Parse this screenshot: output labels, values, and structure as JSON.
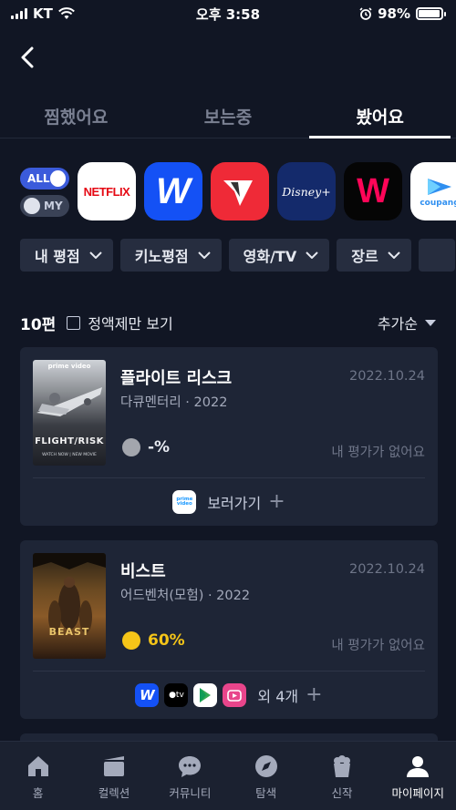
{
  "status_bar": {
    "carrier": "KT",
    "time": "오후 3:58",
    "battery": "98%",
    "battery_level": 0.98
  },
  "tabs": [
    {
      "label": "찜했어요",
      "active": false
    },
    {
      "label": "보는중",
      "active": false
    },
    {
      "label": "봤어요",
      "active": true
    }
  ],
  "ott_toggles": {
    "all_label": "ALL",
    "my_label": "MY"
  },
  "ott_services": [
    {
      "name": "netflix-icon",
      "label": "NETFLIX"
    },
    {
      "name": "wavve-icon",
      "label": "W"
    },
    {
      "name": "tving-icon",
      "label": "T"
    },
    {
      "name": "disney-plus-icon",
      "label": "Disney+"
    },
    {
      "name": "watcha-icon",
      "label": "W"
    },
    {
      "name": "coupang-play-icon",
      "label": "coupang"
    }
  ],
  "filters": [
    "내 평점",
    "키노평점",
    "영화/TV",
    "장르"
  ],
  "list": {
    "count": "10편",
    "checkbox_label": "정액제만 보기",
    "sort_label": "추가순"
  },
  "cards": [
    {
      "title": "플라이트 리스크",
      "meta": "다큐멘터리 · 2022",
      "date": "2022.10.24",
      "score": "-%",
      "my_rating": "내 평가가 없어요",
      "poster_brand": "prime video",
      "poster_title": "FLIGHT/RISK",
      "poster_tag": "WATCH NOW | NEW MOVIE",
      "footer_provider": "prime video",
      "footer_label": "보러가기"
    },
    {
      "title": "비스트",
      "meta": "어드벤처(모험) · 2022",
      "date": "2022.10.24",
      "score": "60%",
      "my_rating": "내 평가가 없어요",
      "poster_title": "BEAST",
      "footer_label": "외 4개"
    }
  ],
  "bottom_nav": [
    {
      "label": "홈",
      "icon": "home-icon",
      "active": false
    },
    {
      "label": "컬렉션",
      "icon": "collection-icon",
      "active": false
    },
    {
      "label": "커뮤니티",
      "icon": "community-icon",
      "active": false
    },
    {
      "label": "탐색",
      "icon": "explore-icon",
      "active": false
    },
    {
      "label": "신작",
      "icon": "new-release-icon",
      "active": false
    },
    {
      "label": "마이페이지",
      "icon": "my-page-icon",
      "active": true
    }
  ],
  "colors": {
    "background": "#111624",
    "card": "#1e2536",
    "accent": "#3b5bdb",
    "score_yellow": "#f5c518"
  }
}
